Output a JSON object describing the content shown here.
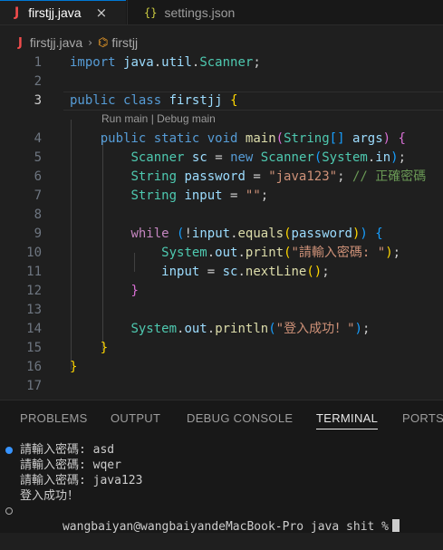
{
  "tabs": [
    {
      "icon": "java-icon",
      "label": "firstjj.java",
      "close": "×"
    },
    {
      "icon": "json-icon",
      "label": "settings.json"
    }
  ],
  "breadcrumb": {
    "file": "firstjj.java",
    "symbol": "firstjj"
  },
  "codelens": "Run main | Debug main",
  "code_lines": [
    {
      "n": "1",
      "text": "import java.util.Scanner;"
    },
    {
      "n": "2",
      "text": ""
    },
    {
      "n": "3",
      "text": "public class firstjj {"
    },
    {
      "n": "4",
      "text": "    public static void main(String[] args) {"
    },
    {
      "n": "5",
      "text": "        Scanner sc = new Scanner(System.in);"
    },
    {
      "n": "6",
      "text": "        String password = \"java123\"; // 正確密碼"
    },
    {
      "n": "7",
      "text": "        String input = \"\";"
    },
    {
      "n": "8",
      "text": ""
    },
    {
      "n": "9",
      "text": "        while (!input.equals(password)) {"
    },
    {
      "n": "10",
      "text": "            System.out.print(\"請輸入密碼: \");"
    },
    {
      "n": "11",
      "text": "            input = sc.nextLine();"
    },
    {
      "n": "12",
      "text": "        }"
    },
    {
      "n": "13",
      "text": ""
    },
    {
      "n": "14",
      "text": "        System.out.println(\"登入成功！\");"
    },
    {
      "n": "15",
      "text": "    }"
    },
    {
      "n": "16",
      "text": "}"
    },
    {
      "n": "17",
      "text": ""
    }
  ],
  "panel": {
    "tabs": [
      "PROBLEMS",
      "OUTPUT",
      "DEBUG CONSOLE",
      "TERMINAL",
      "PORTS"
    ],
    "active_tab": "TERMINAL"
  },
  "terminal_lines": [
    "請輸入密碼: asd",
    "請輸入密碼: wqer",
    "請輸入密碼: java123",
    "登入成功！",
    "wangbaiyan@wangbaiyandeMacBook-Pro java shit %"
  ]
}
